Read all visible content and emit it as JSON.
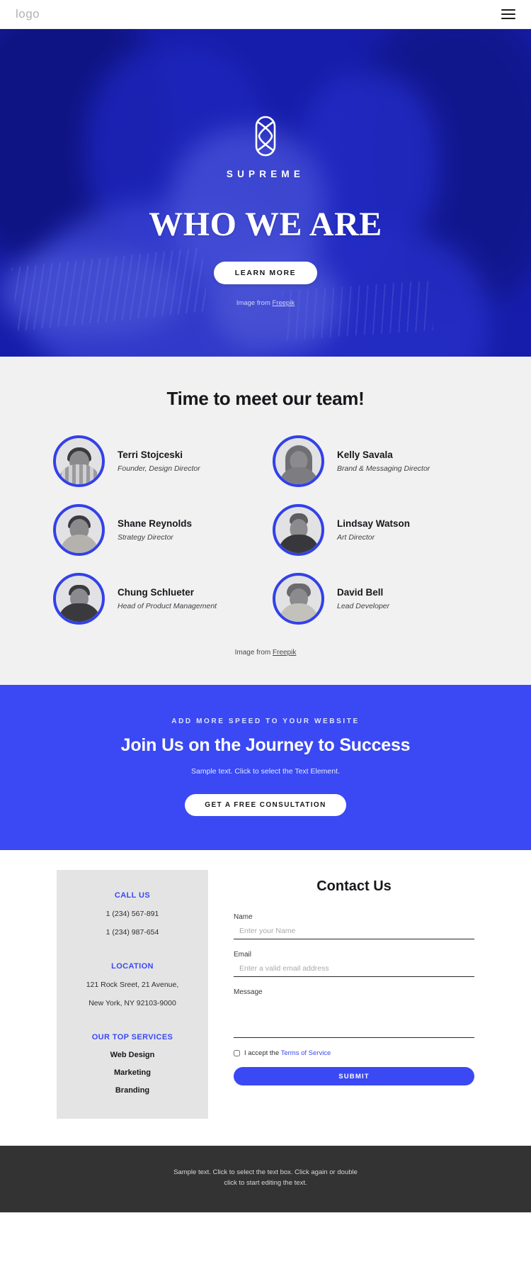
{
  "header": {
    "logo_text": "logo",
    "menu_icon": "hamburger-menu-icon"
  },
  "hero": {
    "brand_icon": "supreme-interlocking-s-logo",
    "brand_name": "SUPREME",
    "title": "WHO WE ARE",
    "cta_label": "LEARN MORE",
    "credit_prefix": "Image from ",
    "credit_link": "Freepik",
    "overlay_color": "#2c39c8"
  },
  "team": {
    "title": "Time to meet our team!",
    "credit_prefix": "Image from ",
    "credit_link": "Freepik",
    "ring_color": "#3341e8",
    "members": [
      {
        "name": "Terri Stojceski",
        "role": "Founder, Design Director",
        "avatar": "avatar-bearded-man-plaid-shirt"
      },
      {
        "name": "Kelly Savala",
        "role": "Brand & Messaging Director",
        "avatar": "avatar-woman-glasses-long-hair"
      },
      {
        "name": "Shane Reynolds",
        "role": "Strategy Director",
        "avatar": "avatar-man-dark-hair-beard"
      },
      {
        "name": "Lindsay Watson",
        "role": "Art Director",
        "avatar": "avatar-woman-glasses-bun"
      },
      {
        "name": "Chung Schlueter",
        "role": "Head of Product Management",
        "avatar": "avatar-man-short-hair-dark-sweater"
      },
      {
        "name": "David Bell",
        "role": "Lead Developer",
        "avatar": "avatar-man-curly-hair-light-shirt"
      }
    ]
  },
  "cta": {
    "eyebrow": "ADD MORE SPEED TO YOUR WEBSITE",
    "title": "Join Us on the Journey to Success",
    "subtext": "Sample text. Click to select the Text Element.",
    "button_label": "GET A FREE CONSULTATION",
    "background_color": "#3a49f3"
  },
  "contact": {
    "info": {
      "call_us_heading": "CALL US",
      "phone_1": "1 (234) 567-891",
      "phone_2": "1 (234) 987-654",
      "location_heading": "LOCATION",
      "address_line_1": "121 Rock Sreet, 21 Avenue,",
      "address_line_2": "New York, NY 92103-9000",
      "services_heading": "OUR TOP SERVICES",
      "service_1": "Web Design",
      "service_2": "Marketing",
      "service_3": "Branding",
      "accent_color": "#3a49f3"
    },
    "form": {
      "title": "Contact Us",
      "name_label": "Name",
      "name_placeholder": "Enter your Name",
      "name_value": "",
      "email_label": "Email",
      "email_placeholder": "Enter a valid email address",
      "email_value": "",
      "message_label": "Message",
      "message_placeholder": "",
      "message_value": "",
      "terms_prefix": "I accept the ",
      "terms_link": "Terms of Service",
      "submit_label": "SUBMIT"
    }
  },
  "footer": {
    "line_1": "Sample text. Click to select the text box. Click again or double",
    "line_2": "click to start editing the text."
  }
}
